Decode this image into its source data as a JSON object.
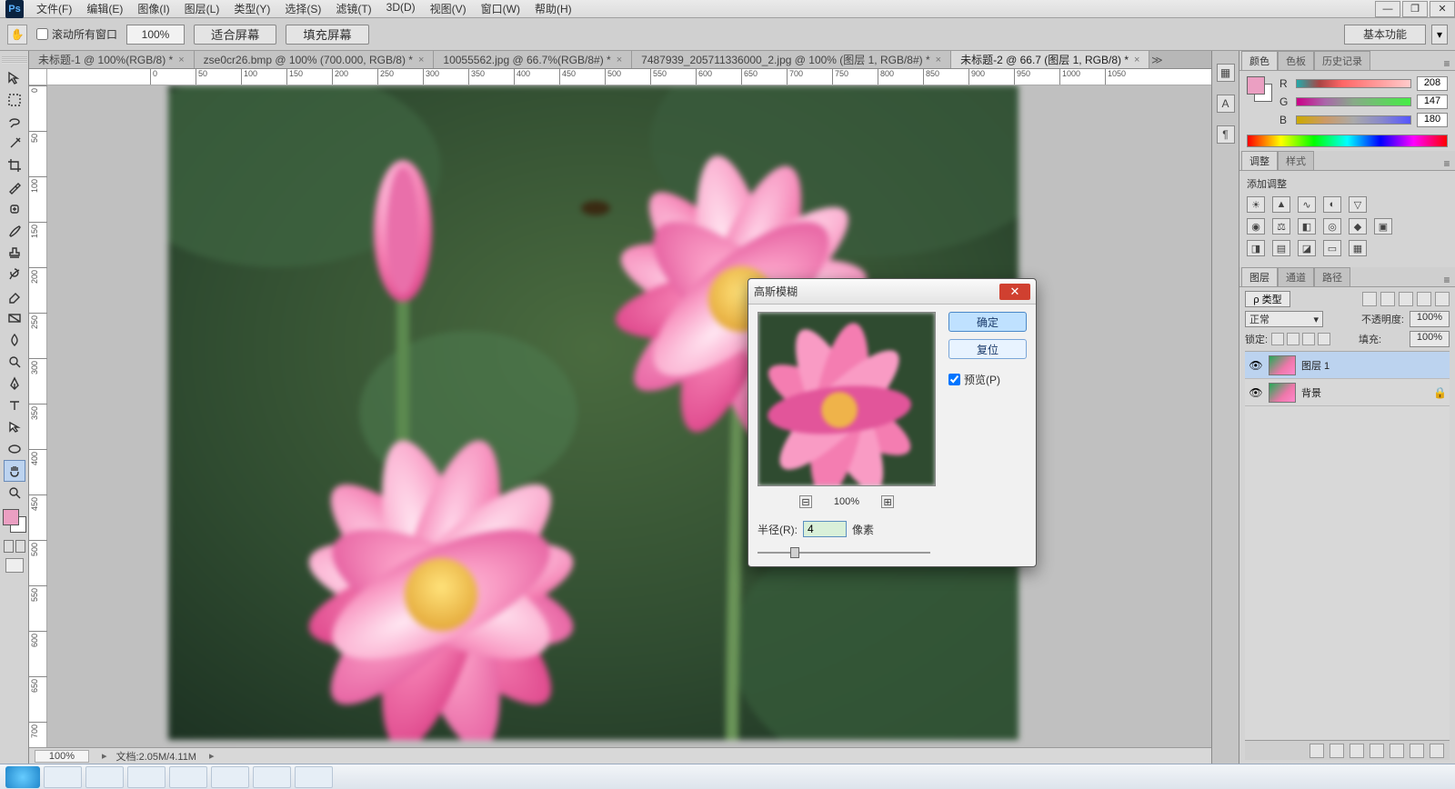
{
  "app": {
    "logo_text": "Ps"
  },
  "menubar": {
    "items": [
      "文件(F)",
      "编辑(E)",
      "图像(I)",
      "图层(L)",
      "类型(Y)",
      "选择(S)",
      "滤镜(T)",
      "3D(D)",
      "视图(V)",
      "窗口(W)",
      "帮助(H)"
    ]
  },
  "window_buttons": {
    "minimize": "—",
    "maximize": "❐",
    "close": "✕"
  },
  "optionsbar": {
    "tool_glyph": "✋",
    "scroll_all_windows": "滚动所有窗口",
    "zoom_level": "100%",
    "fit_screen": "适合屏幕",
    "fill_screen": "填充屏幕",
    "workspace": "基本功能"
  },
  "documents": {
    "tabs": [
      {
        "label": "未标题-1 @ 100%(RGB/8) *",
        "active": false
      },
      {
        "label": "zse0cr26.bmp @ 100% (700.000, RGB/8) *",
        "active": false
      },
      {
        "label": "10055562.jpg @ 66.7%(RGB/8#) *",
        "active": false
      },
      {
        "label": "7487939_205711336000_2.jpg @ 100% (图层 1, RGB/8#) *",
        "active": false
      },
      {
        "label": "未标题-2 @ 66.7 (图层 1, RGB/8) *",
        "active": true
      }
    ]
  },
  "ruler": {
    "h_ticks": [
      "0",
      "50",
      "100",
      "150",
      "200",
      "250",
      "300",
      "350",
      "400",
      "450",
      "500",
      "550",
      "600",
      "650",
      "700",
      "750",
      "800",
      "850",
      "900",
      "950",
      "1000",
      "1050"
    ],
    "v_ticks": [
      "0",
      "50",
      "100",
      "150",
      "200",
      "250",
      "300",
      "350",
      "400",
      "450",
      "500",
      "550",
      "600",
      "650",
      "700"
    ]
  },
  "statusbar": {
    "zoom": "100%",
    "doc_info": "文档:2.05M/4.11M"
  },
  "panels": {
    "color": {
      "tab_color": "颜色",
      "tab_swatch": "色板",
      "tab_history": "历史记录",
      "r_label": "R",
      "r_value": "208",
      "g_label": "G",
      "g_value": "147",
      "b_label": "B",
      "b_value": "180"
    },
    "adjust": {
      "tab_adjust": "调整",
      "tab_styles": "样式",
      "title": "添加调整"
    },
    "layers": {
      "tab_layers": "图层",
      "tab_channels": "通道",
      "tab_paths": "路径",
      "kind_label": "ρ 类型",
      "blend_mode": "正常",
      "opacity_label": "不透明度:",
      "opacity_value": "100%",
      "lock_label": "锁定:",
      "fill_label": "填充:",
      "fill_value": "100%",
      "items": [
        {
          "name": "图层 1",
          "locked": false,
          "selected": true
        },
        {
          "name": "背景",
          "locked": true,
          "selected": false
        }
      ]
    }
  },
  "dialog": {
    "title": "高斯模糊",
    "ok": "确定",
    "reset": "复位",
    "preview_chk": "预览(P)",
    "preview_zoom": "100%",
    "zoom_out": "⊟",
    "zoom_in": "⊞",
    "radius_label": "半径(R):",
    "radius_value": "4",
    "radius_unit": "像素",
    "close_glyph": "✕"
  },
  "dockstrip": {
    "icons": [
      "▦",
      "A",
      "¶"
    ]
  }
}
